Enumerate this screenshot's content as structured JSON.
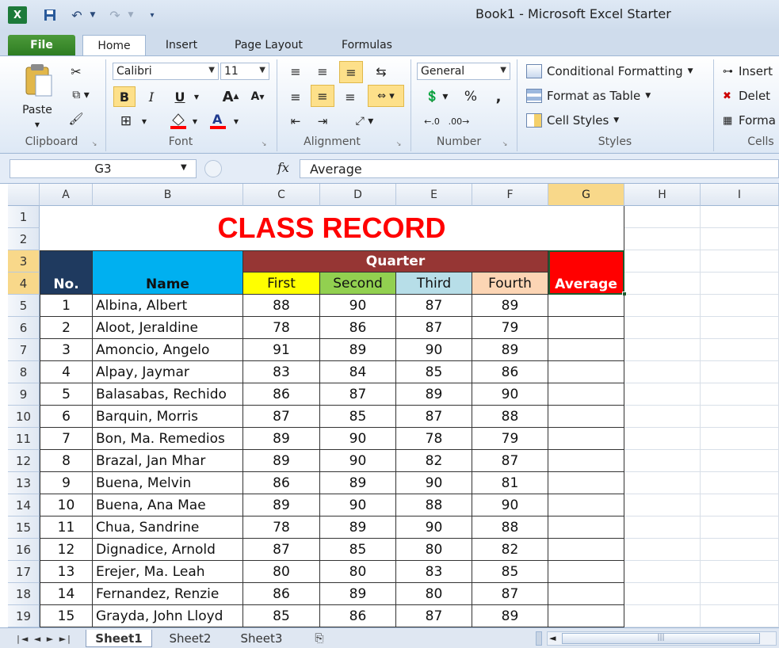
{
  "window": {
    "title": "Book1  -  Microsoft Excel Starter"
  },
  "tabs": [
    "File",
    "Home",
    "Insert",
    "Page Layout",
    "Formulas"
  ],
  "ribbon": {
    "clipboard": {
      "paste": "Paste",
      "label": "Clipboard"
    },
    "font": {
      "name": "Calibri",
      "size": "11",
      "label": "Font",
      "bold": "B",
      "italic": "I",
      "underline": "U"
    },
    "alignment": {
      "label": "Alignment"
    },
    "number": {
      "format": "General",
      "label": "Number",
      "percent": "%",
      "comma": ","
    },
    "styles": {
      "conditional": "Conditional Formatting",
      "table": "Format as Table",
      "cell": "Cell Styles",
      "label": "Styles"
    },
    "cells": {
      "insert": "Insert",
      "delete": "Delet",
      "format": "Forma",
      "label": "Cells"
    }
  },
  "formula_bar": {
    "name_box": "G3",
    "fx": "fx",
    "value": "Average"
  },
  "columns": [
    "A",
    "B",
    "C",
    "D",
    "E",
    "F",
    "G",
    "H",
    "I"
  ],
  "selected_column": "G",
  "rows": [
    "1",
    "2",
    "3",
    "4",
    "5",
    "6",
    "7",
    "8",
    "9",
    "10",
    "11",
    "12",
    "13",
    "14",
    "15",
    "16",
    "17",
    "18",
    "19"
  ],
  "selected_rows": [
    "3",
    "4"
  ],
  "sheet": {
    "title": "CLASS RECORD",
    "quarter_header": "Quarter",
    "headers": {
      "no": "No.",
      "name": "Name",
      "first": "First",
      "second": "Second",
      "third": "Third",
      "fourth": "Fourth",
      "average": "Average"
    },
    "students": [
      [
        "1",
        "Albina, Albert",
        "88",
        "90",
        "87",
        "89"
      ],
      [
        "2",
        "Aloot, Jeraldine",
        "78",
        "86",
        "87",
        "79"
      ],
      [
        "3",
        "Amoncio, Angelo",
        "91",
        "89",
        "90",
        "89"
      ],
      [
        "4",
        "Alpay, Jaymar",
        "83",
        "84",
        "85",
        "86"
      ],
      [
        "5",
        "Balasabas, Rechido",
        "86",
        "87",
        "89",
        "90"
      ],
      [
        "6",
        "Barquin, Morris",
        "87",
        "85",
        "87",
        "88"
      ],
      [
        "7",
        "Bon, Ma. Remedios",
        "89",
        "90",
        "78",
        "79"
      ],
      [
        "8",
        "Brazal, Jan Mhar",
        "89",
        "90",
        "82",
        "87"
      ],
      [
        "9",
        "Buena, Melvin",
        "86",
        "89",
        "90",
        "81"
      ],
      [
        "10",
        "Buena, Ana Mae",
        "89",
        "90",
        "88",
        "90"
      ],
      [
        "11",
        "Chua, Sandrine",
        "78",
        "89",
        "90",
        "88"
      ],
      [
        "12",
        "Dignadice, Arnold",
        "87",
        "85",
        "80",
        "82"
      ],
      [
        "13",
        "Erejer, Ma. Leah",
        "80",
        "80",
        "83",
        "85"
      ],
      [
        "14",
        "Fernandez, Renzie",
        "86",
        "89",
        "80",
        "87"
      ],
      [
        "15",
        "Grayda, John Lloyd",
        "85",
        "86",
        "87",
        "89"
      ]
    ]
  },
  "sheet_tabs": [
    "Sheet1",
    "Sheet2",
    "Sheet3"
  ],
  "colors": {
    "title_red": "#ff0000",
    "no_header": "#1f3a5f",
    "name_header": "#00b0f0",
    "quarter_header": "#963634",
    "first": "#ffff00",
    "second": "#92d050",
    "third": "#b7dee8",
    "fourth": "#fcd5b4",
    "average": "#ff0000"
  }
}
